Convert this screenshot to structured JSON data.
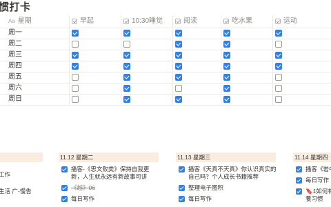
{
  "page": {
    "title": "惯打卡"
  },
  "table": {
    "columns": [
      {
        "label": "星期",
        "prefix": "Aa"
      },
      {
        "label": "早起"
      },
      {
        "label": "10:30睡觉"
      },
      {
        "label": "阅读"
      },
      {
        "label": "吃水果"
      },
      {
        "label": "运动"
      }
    ],
    "rows": [
      {
        "day": "周一",
        "checks": [
          true,
          true,
          true,
          true,
          true
        ]
      },
      {
        "day": "周二",
        "checks": [
          false,
          false,
          true,
          true,
          false
        ]
      },
      {
        "day": "周三",
        "checks": [
          true,
          true,
          true,
          true,
          true
        ]
      },
      {
        "day": "周四",
        "checks": [
          true,
          true,
          true,
          true,
          true
        ]
      },
      {
        "day": "周五",
        "checks": [
          false,
          true,
          true,
          true,
          false
        ]
      },
      {
        "day": "周六",
        "checks": [
          false,
          true,
          false,
          true,
          false
        ]
      },
      {
        "day": "周日",
        "checks": [
          false,
          true,
          true,
          true,
          false
        ]
      }
    ]
  },
  "board": {
    "left_fragments": [
      "工作",
      "生活 广-慢告"
    ],
    "columns": [
      {
        "header": "11.12 星期二",
        "tasks": [
          {
            "lines": [
              "播客-《思文败类》保持自我更",
              "新，人生就永远有新故事可讲"
            ],
            "checked": true,
            "strike": false
          },
          {
            "lines": [
              "《越》06"
            ],
            "checked": true,
            "strike": true
          },
          {
            "lines": [
              "每日写作"
            ],
            "checked": true,
            "strike": false
          }
        ]
      },
      {
        "header": "11.13 星期三",
        "tasks": [
          {
            "lines": [
              "播客《天真不天真》你认识真实的",
              "自己吗？个人成长书籍推荐"
            ],
            "checked": true,
            "strike": false
          },
          {
            "lines": [
              "整理电子图积"
            ],
            "checked": true,
            "strike": false
          },
          {
            "lines": [
              "每日写作"
            ],
            "checked": true,
            "strike": false
          }
        ]
      },
      {
        "header": "11.14 星期四",
        "tasks": [
          {
            "lines": [
              "播客《岩中"
            ],
            "checked": true,
            "strike": false
          },
          {
            "lines": [
              "每日写作"
            ],
            "checked": true,
            "strike": false
          },
          {
            "lines": [
              "🔖1如何有",
              "養习惯"
            ],
            "checked": true,
            "strike": false
          }
        ]
      }
    ]
  }
}
